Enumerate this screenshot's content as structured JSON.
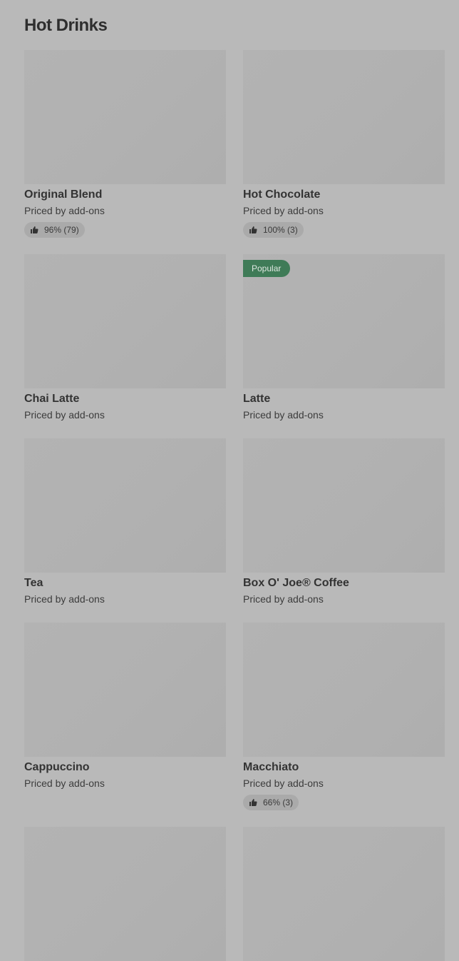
{
  "section": {
    "title": "Hot Drinks"
  },
  "items": [
    {
      "name": "Original Blend",
      "price": "Priced by add-ons",
      "rating": "96% (79)"
    },
    {
      "name": "Hot Chocolate",
      "price": "Priced by add-ons",
      "rating": "100% (3)"
    },
    {
      "name": "Chai Latte",
      "price": "Priced by add-ons"
    },
    {
      "name": "Latte",
      "price": "Priced by add-ons",
      "tag": "Popular"
    },
    {
      "name": "Tea",
      "price": "Priced by add-ons"
    },
    {
      "name": "Box O' Joe® Coffee",
      "price": "Priced by add-ons"
    },
    {
      "name": "Cappuccino",
      "price": "Priced by add-ons"
    },
    {
      "name": "Macchiato",
      "price": "Priced by add-ons",
      "rating": "66% (3)"
    }
  ],
  "icons": {
    "rating": "thumbs-up-icon"
  }
}
